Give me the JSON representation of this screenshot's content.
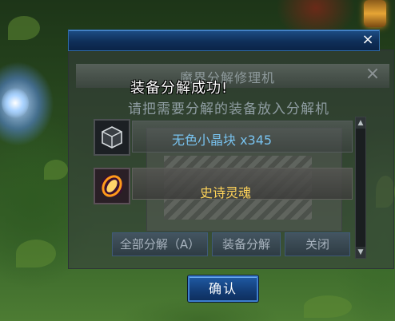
{
  "popup": {
    "close_label": "×",
    "message": "装备分解成功!",
    "confirm_label": "确认",
    "bar_color": "#1d4d86"
  },
  "dialog": {
    "title": "魔界分解修理机",
    "close_label": "×",
    "subtitle": "请把需要分解的装备放入分解机",
    "items": [
      {
        "name": "无色小晶块 x345",
        "color": "#78c2ee",
        "icon": "crystal-cube-icon"
      },
      {
        "name": "史诗灵魂",
        "color": "#ffd45a",
        "icon": "epic-soul-icon"
      }
    ],
    "buttons": {
      "disassemble_all": "全部分解（A）",
      "disassemble_equipment": "装备分解",
      "close": "关闭"
    },
    "scroll": {
      "up": "▲",
      "down": "▼"
    }
  }
}
